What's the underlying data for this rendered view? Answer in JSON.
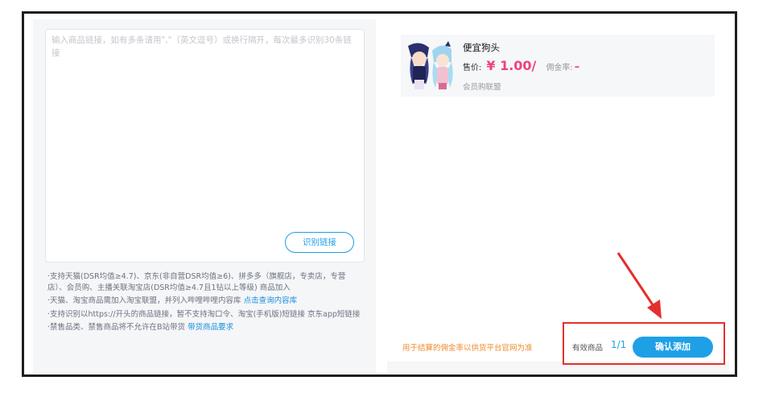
{
  "link_input": {
    "placeholder": "输入商品链接，如有多条请用\",\"（英文逗号）或换行隔开，每次最多识别30条链接",
    "recognize_button": "识别链接"
  },
  "notes": [
    {
      "text": "支持天猫(DSR均值≥4.7)、京东(非自营DSR均值≥6)、拼多多（旗舰店，专卖店，专营店）、会员购、主播关联淘宝店(DSR均值≥4.7且1钻以上等级) 商品加入",
      "link": ""
    },
    {
      "text": "天猫、淘宝商品需加入淘宝联盟，并列入哔哩哔哩内容库 ",
      "link": "点击查询内容库"
    },
    {
      "text": "支持识别以https://开头的商品链接，暂不支持淘口令、淘宝(手机版)短链接 京东app短链接",
      "link": ""
    },
    {
      "text": "禁售品类、禁售商品将不允许在B站带货 ",
      "link": "带货商品要求"
    }
  ],
  "product": {
    "name": "便宜狗头",
    "price_label": "售价:",
    "price": "¥ 1.00/",
    "commission_label": "佣金率:",
    "commission": "–",
    "source": "会员购联盟"
  },
  "footer": {
    "note": "用于结算的佣金率以供货平台官网为准",
    "valid_label": "有效商品",
    "valid_count": "1/1",
    "confirm_button": "确认添加"
  },
  "colors": {
    "accent": "#1ea0e6",
    "price": "#f0417a",
    "warning": "#f08a2c",
    "highlight": "#e3302d"
  }
}
